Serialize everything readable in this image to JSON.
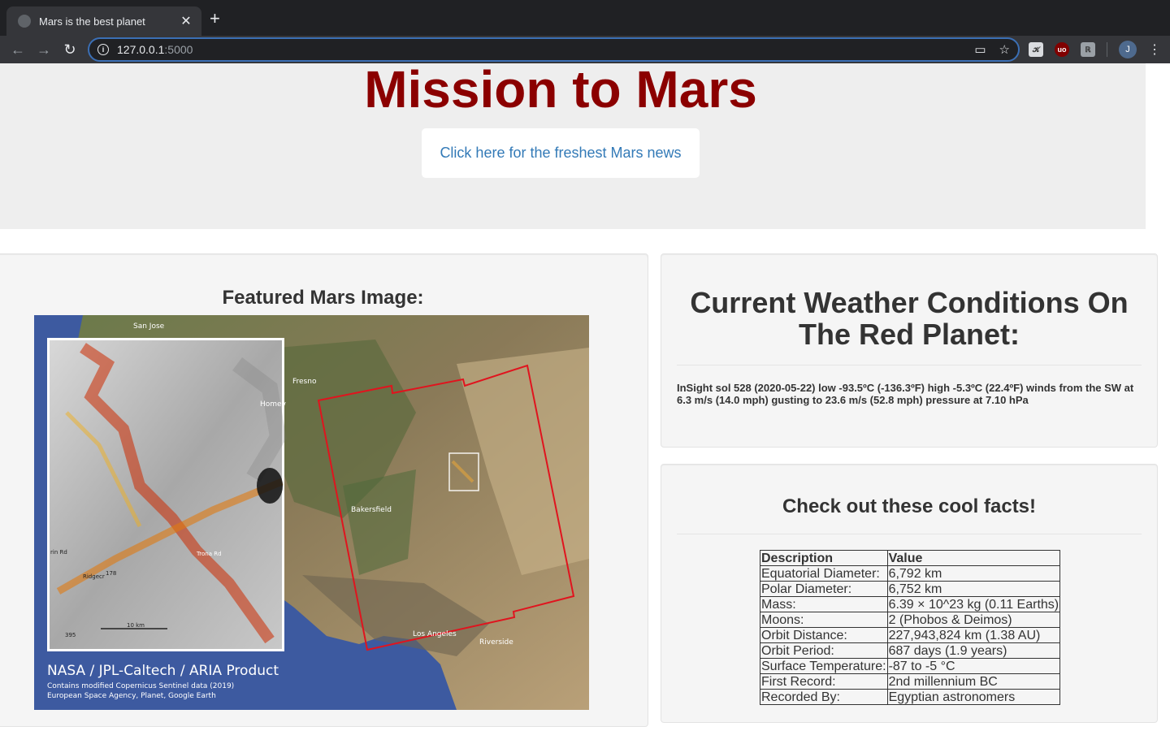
{
  "browser": {
    "tab_title": "Mars is the best planet",
    "tab_close": "✕",
    "new_tab": "+",
    "url_host": "127.0.0.1",
    "url_port": ":5000",
    "avatar_initial": "J",
    "ext_labels": [
      "𝓚",
      "uo",
      "ℝ"
    ],
    "back_icon": "←",
    "forward_icon": "→",
    "reload_icon": "↻",
    "info_icon": "i",
    "star_icon": "☆",
    "cast_icon": "▭",
    "menu_icon": "⋮"
  },
  "jumbotron": {
    "title": "Mission to Mars",
    "button_label": "Click here for the freshest Mars news"
  },
  "featured": {
    "title": "Featured Mars Image:",
    "caption_main": "NASA / JPL-Caltech / ARIA Product",
    "caption_line1": "Contains modified Copernicus Sentinel data (2019)",
    "caption_line2": "European Space Agency, Planet, Google Earth",
    "places": [
      "San Jose",
      "Fresno",
      "Homev",
      "Bakersfield",
      "Los Angeles",
      "Riverside",
      "Ridgecr",
      "rin Rd",
      "10 km",
      "395",
      "178",
      "Trona Rd"
    ]
  },
  "weather": {
    "title": "Current Weather Conditions On The Red Planet:",
    "text": "InSight sol 528 (2020-05-22) low -93.5ºC (-136.3ºF) high -5.3ºC (22.4ºF) winds from the SW at 6.3 m/s (14.0 mph) gusting to 23.6 m/s (52.8 mph) pressure at 7.10 hPa"
  },
  "facts": {
    "title": "Check out these cool facts!",
    "headers": [
      "Description",
      "Value"
    ],
    "rows": [
      [
        "Equatorial Diameter:",
        "6,792 km"
      ],
      [
        "Polar Diameter:",
        "6,752 km"
      ],
      [
        "Mass:",
        "6.39 × 10^23 kg (0.11 Earths)"
      ],
      [
        "Moons:",
        "2 (Phobos & Deimos)"
      ],
      [
        "Orbit Distance:",
        "227,943,824 km (1.38 AU)"
      ],
      [
        "Orbit Period:",
        "687 days (1.9 years)"
      ],
      [
        "Surface Temperature:",
        "-87 to -5 °C"
      ],
      [
        "First Record:",
        "2nd millennium BC"
      ],
      [
        "Recorded By:",
        "Egyptian astronomers"
      ]
    ]
  },
  "colors": {
    "title_red": "#8b0000",
    "link_blue": "#337ab7",
    "jumbotron_bg": "#eeeeee",
    "chrome_dark": "#202124"
  }
}
